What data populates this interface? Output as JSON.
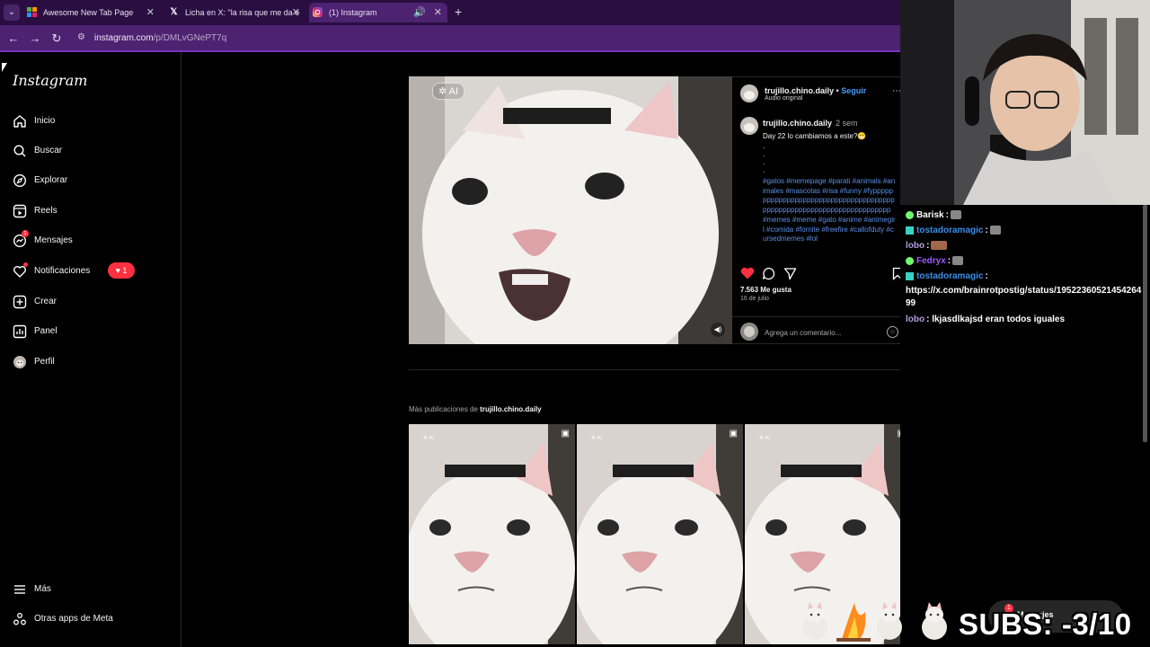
{
  "browser": {
    "tabs": [
      {
        "label": "Awesome New Tab Page",
        "icon": "grid-icon",
        "active": false
      },
      {
        "label": "Licha en X: \"la risa que me da e",
        "icon": "x-logo-icon",
        "active": false
      },
      {
        "label": "(1) Instagram",
        "icon": "instagram-icon",
        "active": true
      }
    ],
    "new_tab": "+",
    "url_host": "instagram.com",
    "url_path": "/p/DMLvGNePT7q",
    "accent": "#7a30c0"
  },
  "sidebar": {
    "logo": "Instagram",
    "items": [
      {
        "label": "Inicio",
        "icon": "home-icon"
      },
      {
        "label": "Buscar",
        "icon": "search-icon"
      },
      {
        "label": "Explorar",
        "icon": "compass-icon"
      },
      {
        "label": "Reels",
        "icon": "reels-icon"
      },
      {
        "label": "Mensajes",
        "icon": "messenger-icon"
      },
      {
        "label": "Notificaciones",
        "icon": "heart-icon"
      },
      {
        "label": "Crear",
        "icon": "plus-square-icon"
      },
      {
        "label": "Panel",
        "icon": "chart-icon"
      },
      {
        "label": "Perfil",
        "icon": "avatar-icon"
      }
    ],
    "messages_count": "1",
    "notif_badge": "1",
    "bottom_items": [
      {
        "label": "Más",
        "icon": "menu-icon"
      },
      {
        "label": "Otras apps de Meta",
        "icon": "apps-icon"
      }
    ]
  },
  "post": {
    "ai_label": "AI",
    "author": "trujillo.chino.daily",
    "follow": "Seguir",
    "separator": "•",
    "audio": "Audio original",
    "caption_time": "2 sem",
    "caption": "Day 22 lo cambiamos a este?😁",
    "caption_dots": ".\n.\n.\n.",
    "hashtags": "#gatos #memepage #parati #animals #animales #mascotas #risa #funny #fypppppppppppppppppppppppppppppppppppppppppppppppppppppppppppppppppppppp #memes #meme #gato #anime #animegirl #comida #fornite #freefire #callofduty #cursedmemes #lol",
    "likes": "7.563 Me gusta",
    "date": "16 de julio",
    "comment_placeholder": "Agrega un comentario...",
    "more_prefix": "Más publicaciones de",
    "more_author": "trujillo.chino.daily"
  },
  "chat": {
    "messages": [
      {
        "user": "Barisk",
        "text": ":",
        "color": "#ffffff"
      },
      {
        "user": "tostadoramagic",
        "text": ":",
        "color": "#3c8ee6"
      },
      {
        "user": "lobo",
        "text": ":",
        "color": "#b39ddb"
      },
      {
        "user": "Fedryx",
        "text": ":",
        "color": "#9b59ff"
      },
      {
        "user": "tostadoramagic",
        "text": ":",
        "color": "#3c8ee6"
      }
    ],
    "link": "https://x.com/brainrotpostig/status/1952236052145426499",
    "last_user": "lobo",
    "last_text": ": lkjasdlkajsd eran todos iguales"
  },
  "overlay": {
    "subs": "SUBS: -3/10",
    "messages_label": "Mensajes",
    "messages_count": "1"
  }
}
